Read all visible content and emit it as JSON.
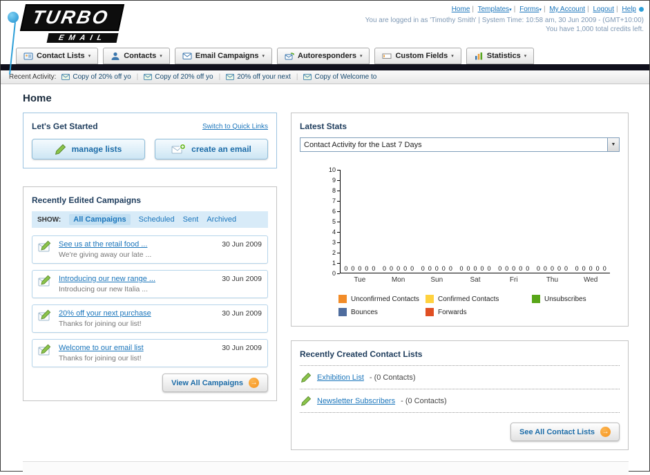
{
  "header": {
    "logo_line1": "TURBO",
    "logo_line2": "EMAIL",
    "nav_links": [
      "Home",
      "Templates",
      "Forms",
      "My Account",
      "Logout",
      "Help"
    ],
    "login_info": "You are logged in as 'Timothy Smith' | System Time: 10:58 am, 30 Jun 2009 - (GMT+10:00)",
    "credits_info": "You have 1,000 total credits left."
  },
  "nav": {
    "tabs": [
      {
        "label": "Contact Lists"
      },
      {
        "label": "Contacts"
      },
      {
        "label": "Email Campaigns"
      },
      {
        "label": "Autoresponders"
      },
      {
        "label": "Custom Fields"
      },
      {
        "label": "Statistics"
      }
    ]
  },
  "recent_activity": {
    "label": "Recent Activity:",
    "items": [
      {
        "label": "Copy of 20% off yo"
      },
      {
        "label": "Copy of 20% off yo"
      },
      {
        "label": "20% off your next"
      },
      {
        "label": "Copy of Welcome to"
      }
    ]
  },
  "page": {
    "title": "Home"
  },
  "get_started": {
    "title": "Let's Get Started",
    "switch_link": "Switch to Quick Links",
    "manage_lists_label": "manage lists",
    "create_email_label": "create an email"
  },
  "campaigns": {
    "title": "Recently Edited Campaigns",
    "show_label": "SHOW:",
    "filters": [
      "All Campaigns",
      "Scheduled",
      "Sent",
      "Archived"
    ],
    "active_filter": "All Campaigns",
    "items": [
      {
        "title": "See us at the retail food ...",
        "desc": "We're giving away our late ...",
        "date": "30 Jun 2009"
      },
      {
        "title": "Introducing our new range ...",
        "desc": "Introducing our new Italia ...",
        "date": "30 Jun 2009"
      },
      {
        "title": "20% off your next purchase",
        "desc": "Thanks for joining our list!",
        "date": "30 Jun 2009"
      },
      {
        "title": "Welcome to our email list",
        "desc": "Thanks for joining our list!",
        "date": "30 Jun 2009"
      }
    ],
    "view_all_label": "View All Campaigns"
  },
  "stats": {
    "title": "Latest Stats",
    "dropdown_value": "Contact Activity for the Last 7 Days",
    "legend": [
      {
        "label": "Unconfirmed Contacts",
        "color": "#f28c28"
      },
      {
        "label": "Confirmed Contacts",
        "color": "#ffd23f"
      },
      {
        "label": "Unsubscribes",
        "color": "#58a618"
      },
      {
        "label": "Bounces",
        "color": "#4f6d9e"
      },
      {
        "label": "Forwards",
        "color": "#e04f23"
      }
    ]
  },
  "chart_data": {
    "type": "bar",
    "title": "Contact Activity for the Last 7 Days",
    "categories": [
      "Tue",
      "Mon",
      "Sun",
      "Sat",
      "Fri",
      "Thu",
      "Wed"
    ],
    "series": [
      {
        "name": "Unconfirmed Contacts",
        "color": "#f28c28",
        "values": [
          0,
          0,
          0,
          0,
          0,
          0,
          0
        ]
      },
      {
        "name": "Confirmed Contacts",
        "color": "#ffd23f",
        "values": [
          0,
          0,
          0,
          0,
          0,
          0,
          0
        ]
      },
      {
        "name": "Unsubscribes",
        "color": "#58a618",
        "values": [
          0,
          0,
          0,
          0,
          0,
          0,
          0
        ]
      },
      {
        "name": "Bounces",
        "color": "#4f6d9e",
        "values": [
          0,
          0,
          0,
          0,
          0,
          0,
          0
        ]
      },
      {
        "name": "Forwards",
        "color": "#e04f23",
        "values": [
          0,
          0,
          0,
          0,
          0,
          0,
          0
        ]
      }
    ],
    "xlabel": "",
    "ylabel": "",
    "ylim": [
      0,
      10
    ],
    "yticks": [
      0,
      1,
      2,
      3,
      4,
      5,
      6,
      7,
      8,
      9,
      10
    ],
    "grid": false,
    "legend_position": "bottom"
  },
  "contact_lists": {
    "title": "Recently Created Contact Lists",
    "items": [
      {
        "name": "Exhibition List",
        "suffix": "- (0 Contacts)"
      },
      {
        "name": "Newsletter Subscribers",
        "suffix": "- (0 Contacts)"
      }
    ],
    "see_all_label": "See All Contact Lists"
  },
  "colors": {
    "link_blue": "#1a75bb",
    "accent_orange": "#f7941d",
    "navbar_dark": "#10101c",
    "swoosh_blue": "#2d9fd8"
  }
}
